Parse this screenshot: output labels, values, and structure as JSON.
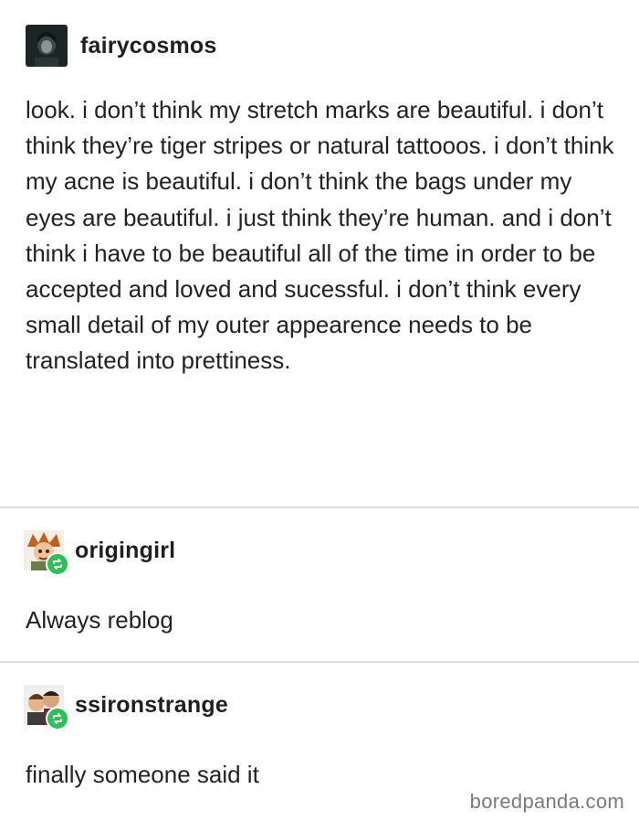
{
  "posts": [
    {
      "username": "fairycosmos",
      "text": "look. i don’t think my stretch marks are beautiful. i don’t think they’re tiger stripes or natural tattooos. i don’t think my acne is beautiful. i don’t think the bags under my eyes are beautiful. i just think they’re human. and i don’t think i have to be beautiful all of the time in order to be accepted and loved and sucessful. i don’t think every small detail of my outer appearence needs to be translated into prettiness."
    },
    {
      "username": "origingirl",
      "text": "Always reblog",
      "icon": "reblog-icon"
    },
    {
      "username": "ssironstrange",
      "text": "finally someone said it",
      "icon": "reblog-icon"
    }
  ],
  "watermark": "boredpanda.com",
  "colors": {
    "reblog_badge": "#2fbf5a",
    "divider": "#dedede",
    "text": "#222222",
    "watermark": "#7a7a7a"
  }
}
